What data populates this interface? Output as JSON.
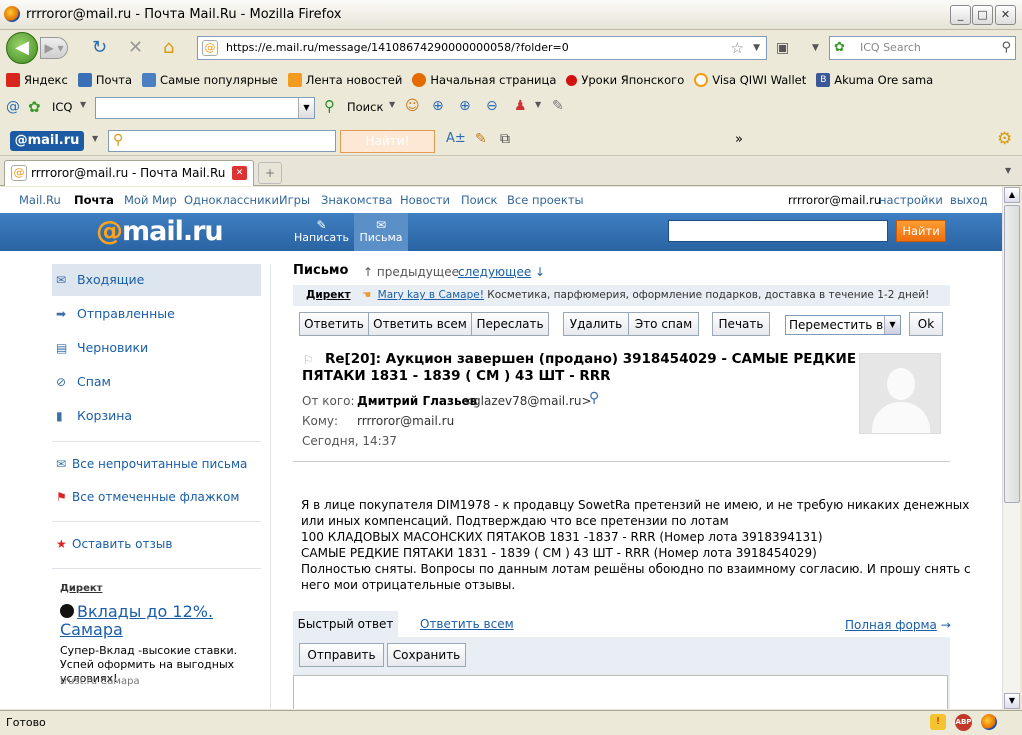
{
  "window": {
    "title": "rrrroror@mail.ru - Почта Mail.Ru - Mozilla Firefox"
  },
  "nav": {
    "url": "https://e.mail.ru/message/14108674290000000058/?folder=0",
    "search_placeholder": "ICQ Search"
  },
  "bookmarks": [
    {
      "label": "Яндекс",
      "color": "#d8261e"
    },
    {
      "label": "Почта",
      "color": "#3b6fb6"
    },
    {
      "label": "Самые популярные",
      "color": "#4a7fc1"
    },
    {
      "label": "Лента новостей",
      "color": "#f29b1f"
    },
    {
      "label": "Начальная страница",
      "color": "#e36b00"
    },
    {
      "label": "Уроки Японского",
      "color": "#d21010"
    },
    {
      "label": "Visa QIWI Wallet",
      "color": "#f39c12"
    },
    {
      "label": "Akuma Ore sama",
      "color": "#3b5998"
    }
  ],
  "icqbar": {
    "icq_label": "ICQ",
    "search_label": "Поиск"
  },
  "mailbar": {
    "logo": "@mail.ru",
    "find_label": "Найти!",
    "more": "»"
  },
  "tab": {
    "label": "rrrroror@mail.ru - Почта Mail.Ru"
  },
  "topnav": {
    "links": [
      "Mail.Ru",
      "Почта",
      "Мой Мир",
      "Одноклассники",
      "Игры",
      "Знакомства",
      "Новости",
      "Поиск",
      "Все проекты"
    ],
    "user": "rrrroror@mail.ru",
    "settings": "настройки",
    "logout": "выход"
  },
  "band": {
    "logo_at": "@",
    "logo_text": "mail.ru",
    "write": "Написать",
    "letters": "Письма",
    "find": "Найти"
  },
  "sidebar": {
    "folders": [
      "Входящие",
      "Отправленные",
      "Черновики",
      "Спам",
      "Корзина"
    ],
    "unread": "Все непрочитанные письма",
    "flagged": "Все отмеченные флажком",
    "feedback": "Оставить отзыв",
    "ad": {
      "label": "Директ",
      "title": "Вклады до 12%. Самара",
      "text": "Супер-Вклад -высокие ставки. Успей оформить на выгодных условиях!",
      "source": "trust.ru  Самара"
    }
  },
  "message": {
    "heading": "Письмо",
    "prev": "предыдущее",
    "next": "следующее",
    "direct_label": "Директ",
    "direct_link": "Mary kay в Самаре!",
    "direct_text": "Косметика, парфюмерия, оформление подарков, доставка в течение 1-2 дней!",
    "buttons": {
      "reply": "Ответить",
      "reply_all": "Ответить всем",
      "forward": "Переслать",
      "delete": "Удалить",
      "spam": "Это спам",
      "print": "Печать",
      "move": "Переместить в",
      "ok": "Ok"
    },
    "subject_1": "Re[20]: Аукцион завершен (продано) 3918454029 - САМЫЕ РЕДКИЕ",
    "subject_2": "ПЯТАКИ 1831 - 1839 ( СМ ) 43 ШТ - RRR",
    "from_label": "От кого:",
    "from_name": "Дмитрий Глазьев",
    "from_email": "<glazev78@mail.ru>",
    "to_label": "Кому:",
    "to": "rrrroror@mail.ru",
    "date": "Сегодня, 14:37",
    "body": [
      "Я в лице покупателя DIM1978 - к продавцу SowetRa претензий не имею, и не требую никаких денежных",
      "или иных компенсаций. Подтверждаю что все претензии по лотам",
      "100 КЛАДОВЫХ МАСОНСКИХ ПЯТАКОВ 1831 -1837 - RRR (Номер лота 3918394131)",
      "САМЫЕ РЕДКИЕ ПЯТАКИ 1831 - 1839 ( СМ ) 43 ШТ - RRR (Номер лота 3918454029)",
      "Полностью сняты. Вопросы по данным лотам решёны обоюдно по взаимному согласию. И прошу снять с",
      "него мои отрицательные отзывы."
    ],
    "quick_reply": "Быстрый ответ",
    "reply_all_link": "Ответить всем",
    "full_form": "Полная форма",
    "send": "Отправить",
    "save": "Сохранить"
  },
  "status": {
    "text": "Готово"
  }
}
